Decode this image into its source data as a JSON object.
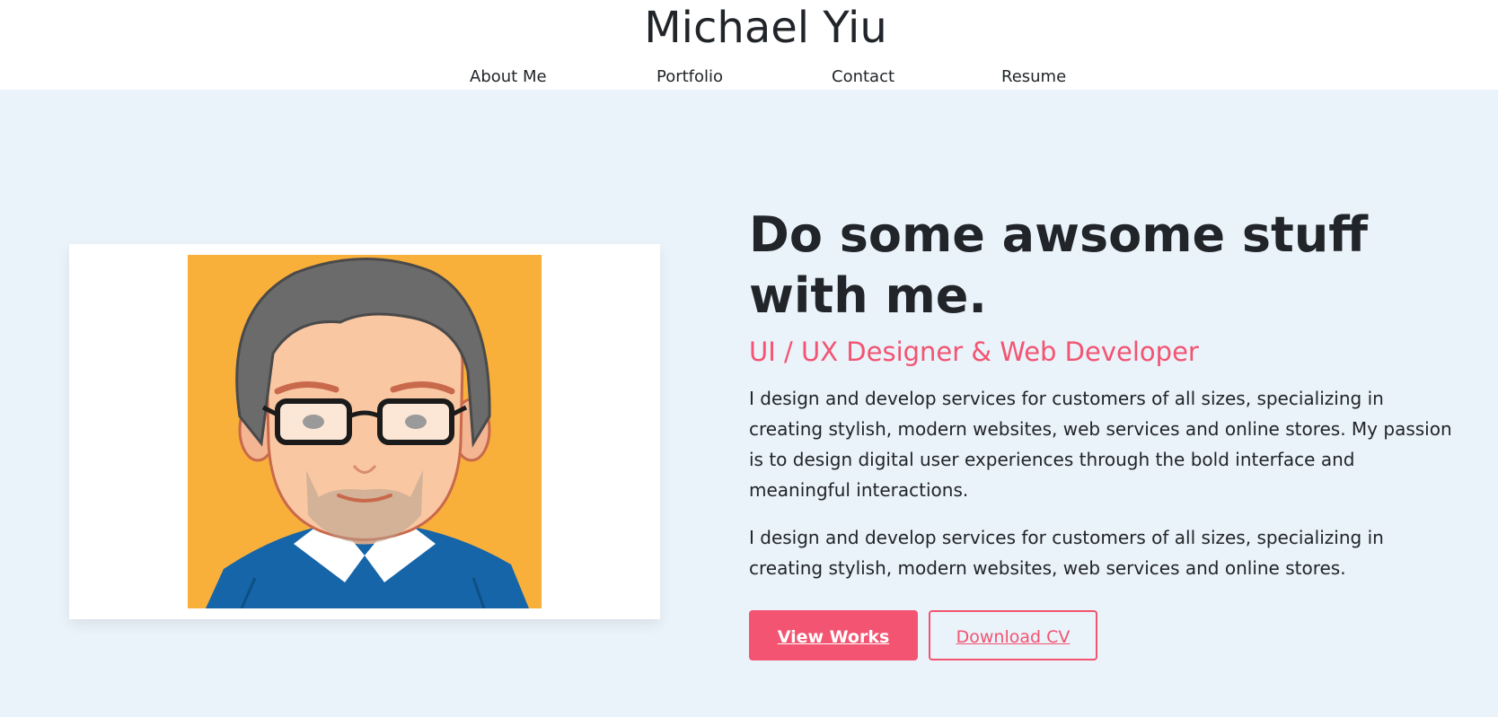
{
  "header": {
    "site_title": "Michael Yiu",
    "nav": [
      "About Me",
      "Portfolio",
      "Contact",
      "Resume"
    ]
  },
  "hero": {
    "headline": "Do some awsome stuff with me.",
    "subtitle": "UI / UX Designer & Web Developer",
    "paragraphs": [
      "I design and develop services for customers of all sizes, specializing in creating stylish, modern websites, web services and online stores. My passion is to design digital user experiences through the bold interface and meaningful interactions.",
      "I design and develop services for customers of all sizes, specializing in creating stylish, modern websites, web services and online stores."
    ],
    "buttons": {
      "view_works": "View Works",
      "download_cv": "Download CV"
    }
  },
  "colors": {
    "accent": "#f25471",
    "hero_background": "#eaf2fa",
    "text": "#212529",
    "avatar_background": "#f9b03b",
    "sweater": "#1565a8"
  },
  "icons": {
    "avatar": "cartoon-man-with-glasses-avatar"
  }
}
